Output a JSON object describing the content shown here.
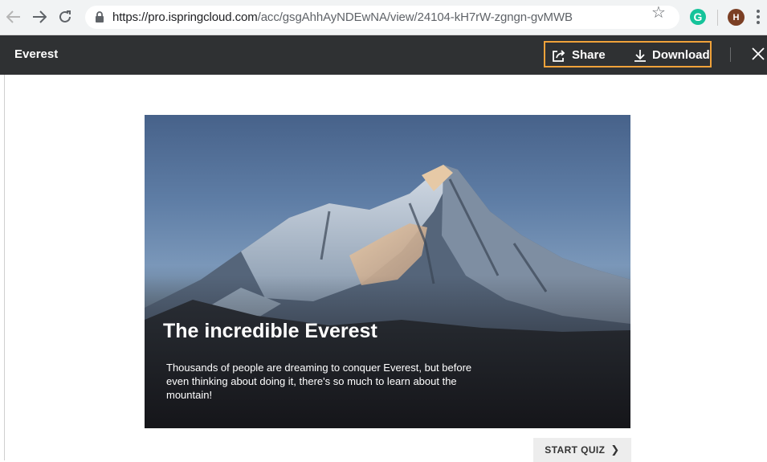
{
  "browser": {
    "url_host": "https://pro.ispringcloud.com",
    "url_path": "/acc/gsgAhhAyNDEwNA/view/24104-kH7rW-zgngn-gvMWB",
    "avatar_initial": "H",
    "grammarly_letter": "G",
    "icons": [
      "back-arrow-icon",
      "forward-arrow-icon",
      "reload-icon",
      "lock-icon",
      "star-icon",
      "grammarly-icon",
      "menu-icon"
    ]
  },
  "viewer": {
    "title": "Everest",
    "share_label": "Share",
    "download_label": "Download",
    "highlight_color": "#f0a23a",
    "bar_color": "#2f3133"
  },
  "slide": {
    "title": "The incredible Everest",
    "description": "Thousands of people are dreaming to conquer Everest, but before even thinking about doing it, there's so much to learn about the mountain!",
    "start_button": "START QUIZ"
  }
}
